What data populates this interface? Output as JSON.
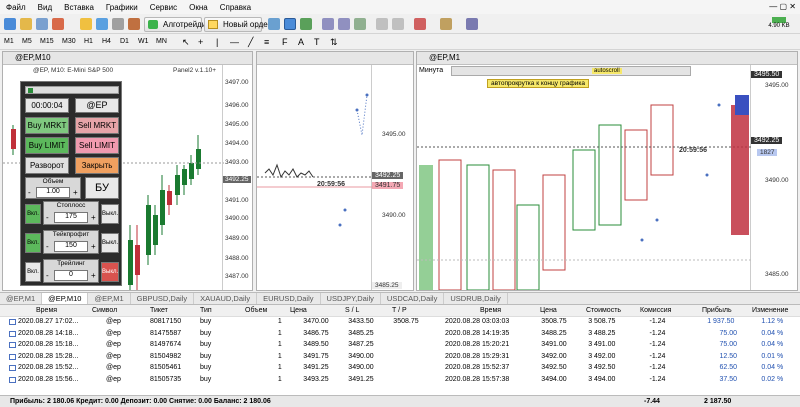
{
  "menu": [
    "Файл",
    "Вид",
    "Вставка",
    "Графики",
    "Сервис",
    "Окна",
    "Справка"
  ],
  "toolbar": {
    "algo_label": "Алготрейдинг",
    "order_label": "Новый ордер",
    "timeframes": [
      "M1",
      "M5",
      "M15",
      "M30",
      "H1",
      "H4",
      "D1",
      "W1",
      "MN"
    ],
    "status": "4.90 KB"
  },
  "windows": {
    "w1": {
      "title": "@EP,M10",
      "info": "@EP, M10: E-Mini S&P 500",
      "panel_ver": "Panel2 v.1.10+",
      "prices": [
        "3497.00",
        "3496.00",
        "3495.00",
        "3494.00",
        "3493.00",
        "3492.00",
        "3491.00",
        "3490.00",
        "3489.00",
        "3488.00",
        "3487.00"
      ],
      "last_price": "3492.25"
    },
    "w2": {
      "prices": [
        "3495.00",
        "3490.00"
      ],
      "last_price": "3492.25",
      "second_price": "3491.75",
      "time": "20:59:56",
      "bottom_price": "3485.25"
    },
    "w3": {
      "title": "@EP,M1",
      "label": "Минута",
      "bar_label": "autoscroll",
      "autoscroll": "автопрокрутка к концу графика",
      "prices": [
        "3495.50",
        "3495.00",
        "3492.25",
        "3490.00",
        "3485.00"
      ],
      "time": "20:59:56",
      "ask": "1827"
    }
  },
  "panel": {
    "timer": "00:00:04",
    "symbol": "@EP",
    "buy_mkt": "Buy MRKT",
    "sell_mkt": "Sell MRKT",
    "buy_limit": "Buy LIMIT",
    "sell_limit": "Sell LIMIT",
    "reverse": "Разворот",
    "close": "Закрыть",
    "volume_label": "Объем",
    "volume": "1.00",
    "bu": "БУ",
    "stoploss_label": "Стоплосс",
    "stoploss": "175",
    "takeprofit_label": "Тейкпрофит",
    "takeprofit": "150",
    "trailing_label": "Трейлинг",
    "trailing": "0",
    "on": "Вкл.",
    "off": "Выкл.",
    "minus": "-",
    "plus": "+"
  },
  "tabs": [
    "@EP,M1",
    "@EP,M10",
    "@EP,M1",
    "GBPUSD,Daily",
    "XAUAUD,Daily",
    "EURUSD,Daily",
    "USDJPY,Daily",
    "USDCAD,Daily",
    "USDRUB,Daily"
  ],
  "table": {
    "headers": [
      "Время",
      "Символ",
      "Тикет",
      "Тип",
      "Объем",
      "Цена",
      "S / L",
      "T / P",
      "Время",
      "Цена",
      "Стоимость",
      "Комиссия",
      "Прибыль",
      "Изменение"
    ],
    "rows": [
      [
        "2020.08.27 17:02...",
        "@ep",
        "80817150",
        "buy",
        "1",
        "3470.00",
        "3433.50",
        "3508.75",
        "2020.08.28 03:03:03",
        "3508.75",
        "3 508.75",
        "-1.24",
        "1 937.50",
        "1.12 %"
      ],
      [
        "2020.08.28 14:18...",
        "@ep",
        "81475587",
        "buy",
        "1",
        "3486.75",
        "3485.25",
        "",
        "2020.08.28 14:19:35",
        "3488.25",
        "3 488.25",
        "-1.24",
        "75.00",
        "0.04 %"
      ],
      [
        "2020.08.28 15:18...",
        "@ep",
        "81497674",
        "buy",
        "1",
        "3489.50",
        "3487.25",
        "",
        "2020.08.28 15:20:21",
        "3491.00",
        "3 491.00",
        "-1.24",
        "75.00",
        "0.04 %"
      ],
      [
        "2020.08.28 15:28...",
        "@ep",
        "81504982",
        "buy",
        "1",
        "3491.75",
        "3490.00",
        "",
        "2020.08.28 15:29:31",
        "3492.00",
        "3 492.00",
        "-1.24",
        "12.50",
        "0.01 %"
      ],
      [
        "2020.08.28 15:52...",
        "@ep",
        "81505461",
        "buy",
        "1",
        "3491.25",
        "3490.00",
        "",
        "2020.08.28 15:52:37",
        "3492.50",
        "3 492.50",
        "-1.24",
        "62.50",
        "0.04 %"
      ],
      [
        "2020.08.28 15:56...",
        "@ep",
        "81505735",
        "buy",
        "1",
        "3493.25",
        "3491.25",
        "",
        "2020.08.28 15:57:38",
        "3494.00",
        "3 494.00",
        "-1.24",
        "37.50",
        "0.02 %"
      ]
    ],
    "footer": "Прибыль: 2 180.06  Кредит: 0.00  Депозит: 0.00  Снятие: 0.00  Баланс: 2 180.06",
    "footer_commission": "-7.44",
    "footer_profit": "2 187.50"
  },
  "colors": {
    "buy_green": "#5cb85c",
    "sell_pink": "#e89aa0",
    "buy_blue": "#5b8fd6",
    "sell_red": "#d9534f",
    "orange": "#f0a060",
    "panel_bg": "#2b2b2b"
  }
}
